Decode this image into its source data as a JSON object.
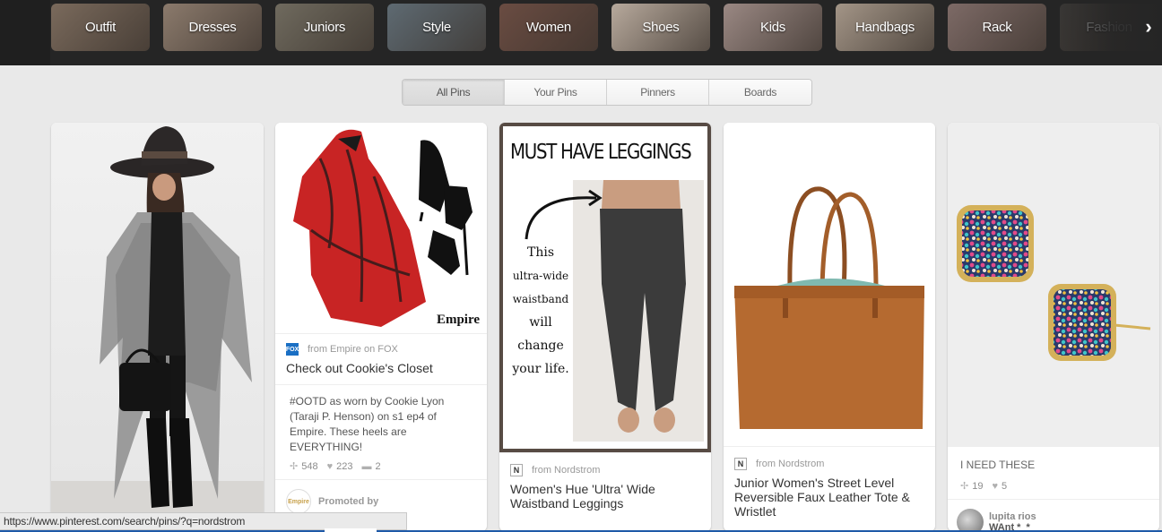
{
  "guide": {
    "tiles": [
      {
        "label": "Outfit",
        "bg": "#7a6a5c"
      },
      {
        "label": "Dresses",
        "bg": "#8b7a6c"
      },
      {
        "label": "Juniors",
        "bg": "#6f6a5e"
      },
      {
        "label": "Style",
        "bg": "#5e6a72"
      },
      {
        "label": "Women",
        "bg": "#6a4c42"
      },
      {
        "label": "Shoes",
        "bg": "#b7a99c"
      },
      {
        "label": "Kids",
        "bg": "#9a8883"
      },
      {
        "label": "Handbags",
        "bg": "#a39587"
      },
      {
        "label": "Rack",
        "bg": "#7d6a66"
      },
      {
        "label": "Fashion",
        "bg": "#3a3836"
      }
    ],
    "next_icon": "chevron-right-icon"
  },
  "filters": [
    {
      "label": "All Pins",
      "active": true
    },
    {
      "label": "Your Pins",
      "active": false
    },
    {
      "label": "Pinners",
      "active": false
    },
    {
      "label": "Boards",
      "active": false
    }
  ],
  "pins": {
    "outfit": {},
    "empire": {
      "image_caption": "Empire",
      "source": "from Empire on FOX",
      "source_icon_text": "FOX",
      "title": "Check out Cookie's Closet",
      "description": "#OOTD as worn by Cookie Lyon (Taraji P. Henson) on s1 ep4 of Empire. These heels are EVERYTHING!",
      "repins": "548",
      "likes": "223",
      "comments": "2",
      "promoted_label": "Promoted by",
      "promoted_icon_text": "Empire"
    },
    "leggings": {
      "headline": "MUST HAVE LEGGINGS",
      "note": [
        "This",
        "ultra-wide",
        "waistband",
        "will",
        "change",
        "your life."
      ],
      "source": "from Nordstrom",
      "source_icon_text": "N",
      "title": "Women's Hue 'Ultra' Wide Waistband Leggings"
    },
    "tote": {
      "source": "from Nordstrom",
      "source_icon_text": "N",
      "title": "Junior Women's Street Level Reversible Faux Leather Tote & Wristlet"
    },
    "earrings": {
      "description": "I NEED THESE",
      "repins": "19",
      "likes": "5",
      "pinner_name": "lupita rios",
      "pinner_board": "WAnt *_*"
    }
  },
  "status_bar": "https://www.pinterest.com/search/pins/?q=nordstrom"
}
